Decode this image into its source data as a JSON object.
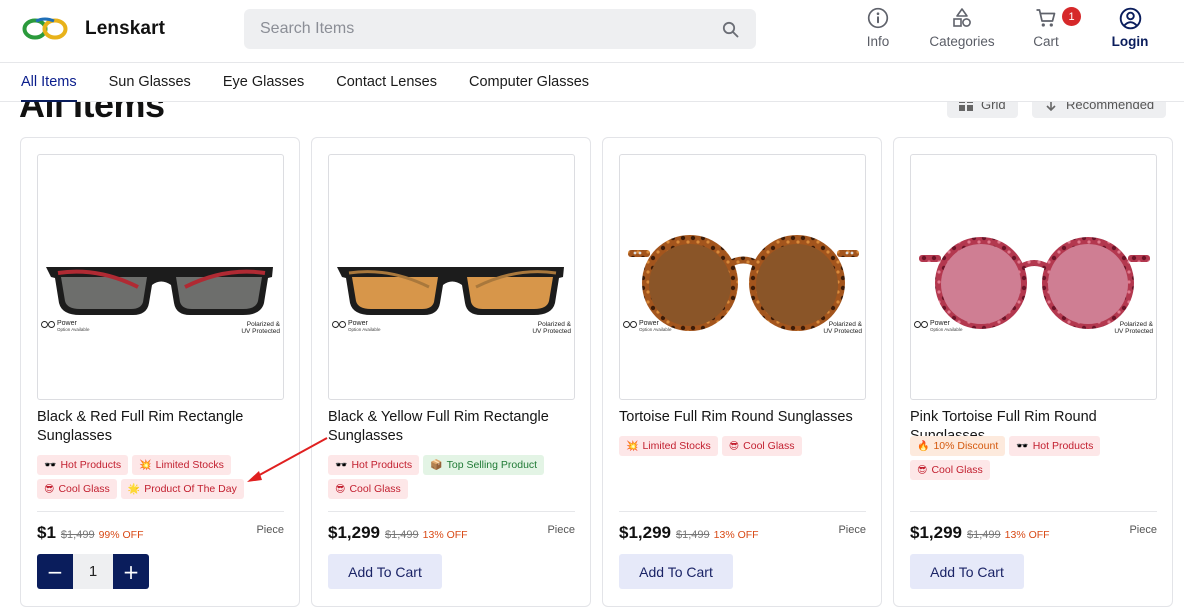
{
  "brand": {
    "name": "Lenskart"
  },
  "search": {
    "placeholder": "Search Items"
  },
  "header_actions": {
    "info": "Info",
    "categories": "Categories",
    "cart": "Cart",
    "cart_count": "1",
    "login": "Login"
  },
  "nav": {
    "items": [
      "All Items",
      "Sun Glasses",
      "Eye Glasses",
      "Contact Lenses",
      "Computer Glasses"
    ],
    "active": "All Items"
  },
  "page": {
    "title": "All Items",
    "view_label": "Grid",
    "sort_label": "Recommended"
  },
  "colors": {
    "primary": "#0a1d5c",
    "accent_red": "#d6282a",
    "button_bg": "#e6e9f9"
  },
  "image_labels": {
    "power": "Power",
    "power_sub": "Option Available",
    "polarized_1": "Polarized &",
    "polarized_2": "UV Protected"
  },
  "products": [
    {
      "name": "Black & Red Full Rim Rectangle Sunglasses",
      "tags": [
        {
          "icon": "sunglasses-emoji",
          "emoji": "🕶️",
          "label": "Hot Products",
          "color": "red"
        },
        {
          "icon": "explosion-emoji",
          "emoji": "💥",
          "label": "Limited Stocks",
          "color": "red"
        },
        {
          "icon": "cool-face-emoji",
          "emoji": "😎",
          "label": "Cool Glass",
          "color": "red"
        },
        {
          "icon": "sparkle-emoji",
          "emoji": "🌟",
          "label": "Product Of The Day",
          "color": "red"
        }
      ],
      "price": "$1",
      "mrp": "$1,499",
      "discount": "99% OFF",
      "unit": "Piece",
      "in_cart": true,
      "quantity": "1",
      "decrement": "−",
      "increment": "+"
    },
    {
      "name": "Black & Yellow Full Rim Rectangle Sunglasses",
      "tags": [
        {
          "icon": "sunglasses-emoji",
          "emoji": "🕶️",
          "label": "Hot Products",
          "color": "red"
        },
        {
          "icon": "package-emoji",
          "emoji": "📦",
          "label": "Top Selling Product",
          "color": "green"
        },
        {
          "icon": "cool-face-emoji",
          "emoji": "😎",
          "label": "Cool Glass",
          "color": "red"
        }
      ],
      "price": "$1,299",
      "mrp": "$1,499",
      "discount": "13% OFF",
      "unit": "Piece",
      "in_cart": false,
      "button": "Add To Cart"
    },
    {
      "name": "Tortoise Full Rim Round Sunglasses",
      "tags": [
        {
          "icon": "explosion-emoji",
          "emoji": "💥",
          "label": "Limited Stocks",
          "color": "red"
        },
        {
          "icon": "cool-face-emoji",
          "emoji": "😎",
          "label": "Cool Glass",
          "color": "red"
        }
      ],
      "price": "$1,299",
      "mrp": "$1,499",
      "discount": "13% OFF",
      "unit": "Piece",
      "in_cart": false,
      "button": "Add To Cart"
    },
    {
      "name": "Pink Tortoise Full Rim Round Sunglasses",
      "tags": [
        {
          "icon": "fire-emoji",
          "emoji": "🔥",
          "label": "10% Discount",
          "color": "orange"
        },
        {
          "icon": "sunglasses-emoji",
          "emoji": "🕶️",
          "label": "Hot Products",
          "color": "red"
        },
        {
          "icon": "cool-face-emoji",
          "emoji": "😎",
          "label": "Cool Glass",
          "color": "red"
        }
      ],
      "price": "$1,299",
      "mrp": "$1,499",
      "discount": "13% OFF",
      "unit": "Piece",
      "in_cart": false,
      "button": "Add To Cart"
    }
  ]
}
